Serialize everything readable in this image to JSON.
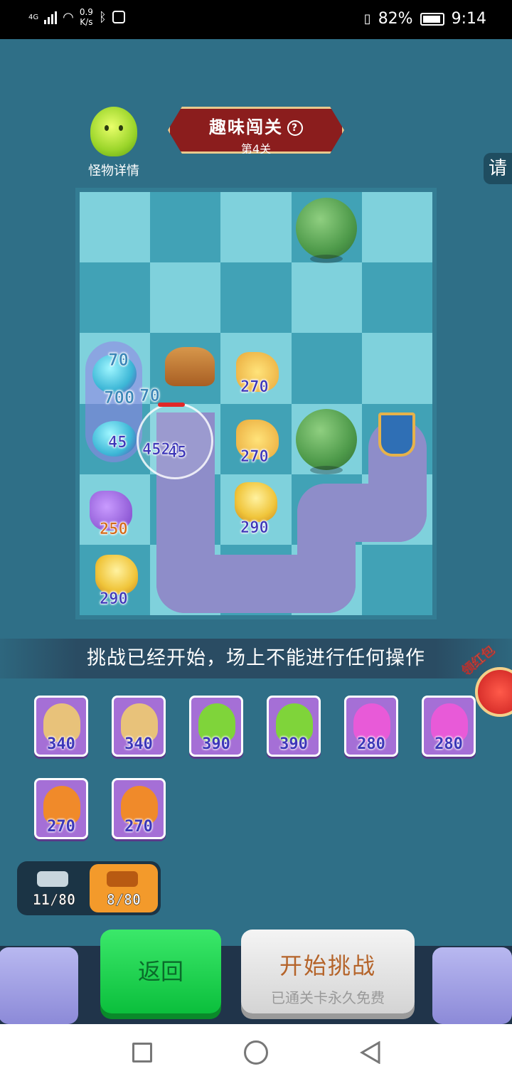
{
  "status_bar": {
    "network": "4G",
    "speed_value": "0.9",
    "speed_unit": "K/s",
    "battery": "82%",
    "time": "9:14",
    "icons": [
      "signal-icon",
      "wifi-icon",
      "bluetooth-icon",
      "app-icon",
      "vibrate-icon",
      "battery-icon"
    ]
  },
  "header": {
    "monster_details_label": "怪物详情",
    "title": "趣味闯关",
    "help_symbol": "?",
    "level": "第4关",
    "side_tab": "请"
  },
  "board": {
    "columns": 5,
    "rows": 6,
    "numbers": {
      "enemy_hp_1": "70",
      "enemy_hp_2": "700",
      "enemy_hp_3": "70",
      "enemy_hp_4": "45",
      "damage_1": "4520",
      "damage_2": "45",
      "tower_purple": "250",
      "tower_bell_bottom": "290",
      "tower_horn_1": "270",
      "tower_horn_2": "270",
      "tower_bell_mid": "290"
    }
  },
  "message": "挑战已经开始，场上不能进行任何操作",
  "red_packet_label": "领红包",
  "cards": [
    {
      "cost": "340",
      "color": "#e8c27a"
    },
    {
      "cost": "340",
      "color": "#e8c27a"
    },
    {
      "cost": "390",
      "color": "#7fd43a"
    },
    {
      "cost": "390",
      "color": "#7fd43a"
    },
    {
      "cost": "280",
      "color": "#e85ad8"
    },
    {
      "cost": "280",
      "color": "#e85ad8"
    },
    {
      "cost": "270",
      "color": "#f08a2a"
    },
    {
      "cost": "270",
      "color": "#f08a2a"
    }
  ],
  "counters": {
    "left": "11/80",
    "right": "8/80"
  },
  "buttons": {
    "back": "返回",
    "start": "开始挑战",
    "start_sub": "已通关卡永久免费"
  },
  "colors": {
    "board_light": "#7fd1dc",
    "board_dark": "#41a2b6",
    "path": "#8e8dc9",
    "title_red": "#8b1d1d",
    "back_green": "#0bbf3c"
  }
}
